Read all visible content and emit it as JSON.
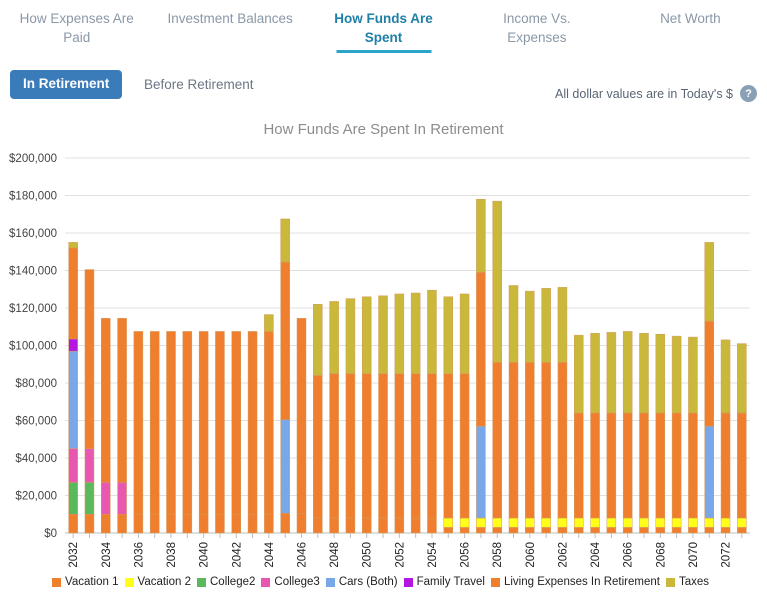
{
  "tabs": [
    {
      "label": "How Expenses Are Paid",
      "active": false
    },
    {
      "label": "Investment Balances",
      "active": false
    },
    {
      "label": "How Funds Are Spent",
      "active": true
    },
    {
      "label": "Income Vs. Expenses",
      "active": false
    },
    {
      "label": "Net Worth",
      "active": false
    }
  ],
  "toggle": {
    "in_retirement": "In Retirement",
    "before_retirement": "Before Retirement",
    "selected": "In Retirement"
  },
  "note": {
    "text": "All dollar values are in Today's $",
    "help_badge": "?"
  },
  "colors": {
    "accent": "#2aa5c7",
    "active_tab_text": "#1f7fa8",
    "inactive_tab_text": "#8a98a8",
    "button_bg": "#3a7cba",
    "title_text": "#8d8d8d"
  },
  "chart_data": {
    "type": "bar",
    "stacked": true,
    "title": "How Funds Are Spent In Retirement",
    "xlabel": "",
    "ylabel": "",
    "ylim": [
      0,
      200000
    ],
    "ytick_labels": [
      "$0",
      "$20,000",
      "$40,000",
      "$60,000",
      "$80,000",
      "$100,000",
      "$120,000",
      "$140,000",
      "$160,000",
      "$180,000",
      "$200,000"
    ],
    "ytick_values": [
      0,
      20000,
      40000,
      60000,
      80000,
      100000,
      120000,
      140000,
      160000,
      180000,
      200000
    ],
    "grid": true,
    "legend_position": "bottom",
    "x": [
      2032,
      2033,
      2034,
      2035,
      2036,
      2037,
      2038,
      2039,
      2040,
      2041,
      2042,
      2043,
      2044,
      2045,
      2046,
      2047,
      2048,
      2049,
      2050,
      2051,
      2052,
      2053,
      2054,
      2055,
      2056,
      2057,
      2058,
      2059,
      2060,
      2061,
      2062,
      2063,
      2064,
      2065,
      2066,
      2067,
      2068,
      2069,
      2070,
      2071,
      2072,
      2073
    ],
    "xtick_labels": [
      "2032",
      "",
      "2034",
      "",
      "2036",
      "",
      "2038",
      "",
      "2040",
      "",
      "2042",
      "",
      "2044",
      "",
      "2046",
      "",
      "2048",
      "",
      "2050",
      "",
      "2052",
      "",
      "2054",
      "",
      "2056",
      "",
      "2058",
      "",
      "2060",
      "",
      "2062",
      "",
      "2064",
      "",
      "2066",
      "",
      "2068",
      "",
      "2070",
      "",
      "2072",
      ""
    ],
    "series": [
      {
        "name": "Vacation 1",
        "color": "#ef7f2f",
        "values": [
          10000,
          10000,
          10000,
          10000,
          10000,
          10000,
          10000,
          10000,
          10000,
          10000,
          10000,
          10000,
          10000,
          10500,
          10500,
          8000,
          8000,
          8000,
          8000,
          8000,
          8000,
          8000,
          8000,
          3000,
          3000,
          3000,
          3000,
          3000,
          3000,
          3000,
          3000,
          3000,
          3000,
          3000,
          3000,
          3000,
          3000,
          3000,
          3000,
          3000,
          3000,
          3000
        ]
      },
      {
        "name": "Vacation 2",
        "color": "#ffff19",
        "values": [
          0,
          0,
          0,
          0,
          0,
          0,
          0,
          0,
          0,
          0,
          0,
          0,
          0,
          0,
          0,
          0,
          0,
          0,
          0,
          0,
          0,
          0,
          0,
          5000,
          5000,
          5000,
          5000,
          5000,
          5000,
          5000,
          5000,
          5000,
          5000,
          5000,
          5000,
          5000,
          5000,
          5000,
          5000,
          5000,
          5000,
          5000
        ]
      },
      {
        "name": "College2",
        "color": "#5cb85c",
        "values": [
          17000,
          17000,
          0,
          0,
          0,
          0,
          0,
          0,
          0,
          0,
          0,
          0,
          0,
          0,
          0,
          0,
          0,
          0,
          0,
          0,
          0,
          0,
          0,
          0,
          0,
          0,
          0,
          0,
          0,
          0,
          0,
          0,
          0,
          0,
          0,
          0,
          0,
          0,
          0,
          0,
          0,
          0
        ]
      },
      {
        "name": "College3",
        "color": "#e858b0",
        "values": [
          18000,
          18000,
          17000,
          17000,
          0,
          0,
          0,
          0,
          0,
          0,
          0,
          0,
          0,
          0,
          0,
          0,
          0,
          0,
          0,
          0,
          0,
          0,
          0,
          0,
          0,
          0,
          0,
          0,
          0,
          0,
          0,
          0,
          0,
          0,
          0,
          0,
          0,
          0,
          0,
          0,
          0,
          0
        ]
      },
      {
        "name": "Cars (Both)",
        "color": "#7aa7e8",
        "values": [
          52000,
          0,
          0,
          0,
          0,
          0,
          0,
          0,
          0,
          0,
          0,
          0,
          0,
          50000,
          0,
          0,
          0,
          0,
          0,
          0,
          0,
          0,
          0,
          0,
          0,
          49000,
          0,
          0,
          0,
          0,
          0,
          0,
          0,
          0,
          0,
          0,
          0,
          0,
          0,
          49000,
          0,
          0
        ]
      },
      {
        "name": "Family Travel",
        "color": "#b515e0",
        "values": [
          6500,
          0,
          0,
          0,
          0,
          0,
          0,
          0,
          0,
          0,
          0,
          0,
          0,
          0,
          0,
          0,
          0,
          0,
          0,
          0,
          0,
          0,
          0,
          0,
          0,
          0,
          0,
          0,
          0,
          0,
          0,
          0,
          0,
          0,
          0,
          0,
          0,
          0,
          0,
          0,
          0,
          0
        ]
      },
      {
        "name": "Living Expenses In Retirement",
        "color": "#ef7f2f",
        "values": [
          48500,
          95500,
          87500,
          87500,
          97500,
          97500,
          97500,
          97500,
          97500,
          97500,
          97500,
          97500,
          97500,
          84000,
          104000,
          76000,
          77000,
          77000,
          77000,
          77000,
          77000,
          77000,
          77000,
          77000,
          77000,
          82000,
          83000,
          83000,
          83000,
          83000,
          83000,
          56000,
          56000,
          56000,
          56000,
          56000,
          56000,
          56000,
          56000,
          56000,
          56000,
          56000
        ]
      },
      {
        "name": "Taxes",
        "color": "#c9b83a",
        "values": [
          3000,
          0,
          0,
          0,
          0,
          0,
          0,
          0,
          0,
          0,
          0,
          0,
          9000,
          23000,
          0,
          38000,
          38500,
          40000,
          41000,
          41500,
          42500,
          43000,
          44500,
          41000,
          42500,
          39000,
          86000,
          41000,
          38000,
          39500,
          40000,
          41500,
          42500,
          43000,
          43500,
          42500,
          42000,
          41000,
          40500,
          42000,
          39000,
          37000
        ]
      }
    ]
  }
}
